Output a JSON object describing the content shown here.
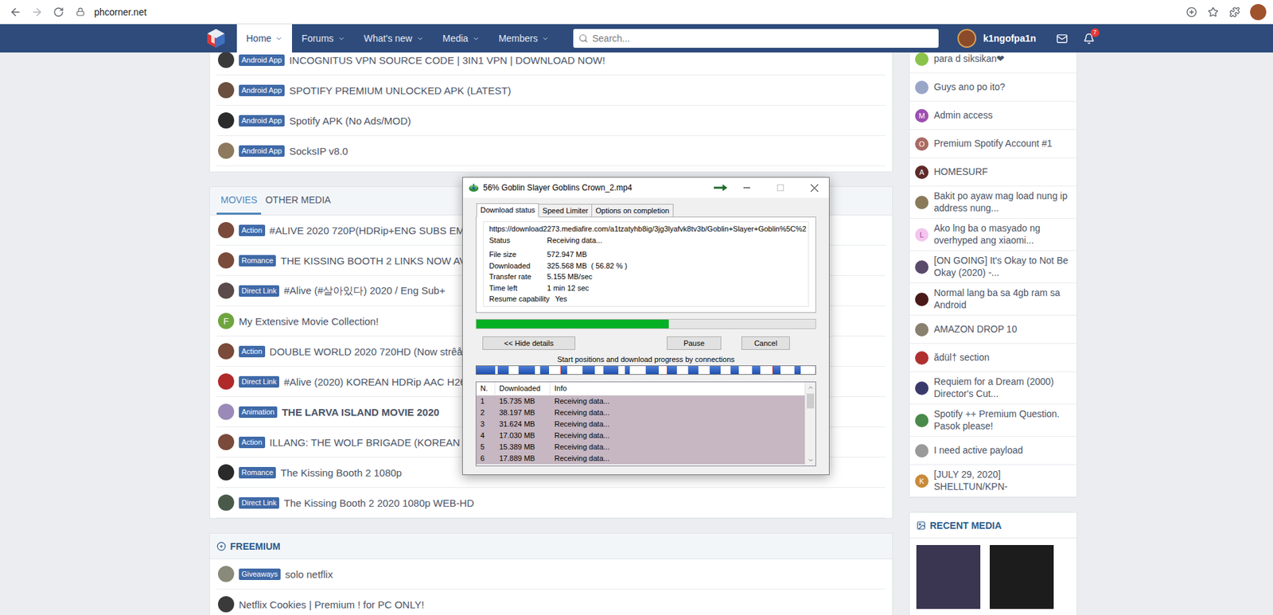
{
  "browser": {
    "url": "phcorner.net",
    "profile_color": "#a0522d"
  },
  "nav": {
    "items": [
      {
        "label": "Home",
        "selected": true
      },
      {
        "label": "Forums",
        "selected": false
      },
      {
        "label": "What's new",
        "selected": false
      },
      {
        "label": "Media",
        "selected": false
      },
      {
        "label": "Members",
        "selected": false
      }
    ],
    "search_placeholder": "Search...",
    "username": "k1ngofpa1n",
    "user_avatar_color": "#8a4b2a",
    "notification_count": "7"
  },
  "top_threads": [
    {
      "tag": "Android App",
      "title": "INCOGNITUS VPN SOURCE CODE | 3IN1 VPN | DOWNLOAD NOW!",
      "unread": false,
      "avatar": {
        "letter": "",
        "color": "#3a3a3a"
      }
    },
    {
      "tag": "Android App",
      "title": "SPOTIFY PREMIUM UNLOCKED APK (LATEST)",
      "unread": false,
      "avatar": {
        "letter": "",
        "color": "#6b4f3f"
      }
    },
    {
      "tag": "Android App",
      "title": "Spotify APK (No Ads/MOD)",
      "unread": false,
      "avatar": {
        "letter": "",
        "color": "#2b2b2b"
      }
    },
    {
      "tag": "Android App",
      "title": "SocksIP v8.0",
      "unread": false,
      "avatar": {
        "letter": "",
        "color": "#8d7a5e"
      }
    }
  ],
  "movies": {
    "tabs": [
      {
        "label": "MOVIES",
        "selected": true
      },
      {
        "label": "OTHER MEDIA",
        "selected": false
      }
    ],
    "rows": [
      {
        "tag": "Action",
        "title": "#ALIVE 2020 720P(HDRip+ENG SUBS EMBEDD",
        "unread": false,
        "avatar": {
          "letter": "",
          "color": "#7a4a3a"
        }
      },
      {
        "tag": "Romance",
        "title": "THE KISSING BOOTH 2 LINKS NOW AVAILAB",
        "unread": false,
        "avatar": {
          "letter": "",
          "color": "#7a4a3a"
        }
      },
      {
        "tag": "Direct Link",
        "title": "#Alive (#살아있다) 2020 / Eng Sub+",
        "unread": false,
        "avatar": {
          "letter": "",
          "color": "#5a4a4a"
        }
      },
      {
        "tag": "",
        "title": "My Extensive Movie Collection!",
        "unread": false,
        "avatar": {
          "letter": "F",
          "color": "#6fa53f"
        }
      },
      {
        "tag": "Action",
        "title": "DOUBLE WORLD 2020 720HD (Now strêåming",
        "unread": false,
        "avatar": {
          "letter": "",
          "color": "#7a4a3a"
        }
      },
      {
        "tag": "Direct Link",
        "title": "#Alive (2020) KOREAN HDRip AAC H264 [7",
        "unread": false,
        "avatar": {
          "letter": "",
          "color": "#b02a2a"
        }
      },
      {
        "tag": "Animation",
        "title": "THE LARVA ISLAND MOVIE 2020",
        "unread": true,
        "avatar": {
          "letter": "",
          "color": "#9a8ab8"
        }
      },
      {
        "tag": "Action",
        "title": "ILLANG: THE WOLF BRIGADE (KOREAN ACTION",
        "unread": false,
        "avatar": {
          "letter": "",
          "color": "#7a4a3a"
        }
      },
      {
        "tag": "Romance",
        "title": "The Kissing Booth 2 1080p",
        "unread": false,
        "avatar": {
          "letter": "",
          "color": "#2a2a2a"
        }
      },
      {
        "tag": "Direct Link",
        "title": "The Kissing Booth 2 2020 1080p WEB-HD",
        "unread": false,
        "avatar": {
          "letter": "",
          "color": "#4a5a4a"
        }
      }
    ]
  },
  "freemium": {
    "title": "FREEMIUM",
    "rows": [
      {
        "tag": "Giveaways",
        "title": "solo netflix",
        "unread": false,
        "avatar": {
          "letter": "",
          "color": "#8a8a7a"
        }
      },
      {
        "tag": "",
        "title": "Netflix Cookies | Premium ! for PC ONLY!",
        "unread": false,
        "avatar": {
          "letter": "",
          "color": "#3a3a3a"
        }
      }
    ]
  },
  "sidebar": {
    "items": [
      {
        "text": "para d siksikan❤",
        "avatar": {
          "letter": "",
          "color": "#8bc34a"
        }
      },
      {
        "text": "Guys ano po ito?",
        "avatar": {
          "letter": "",
          "color": "#9aa6c8"
        }
      },
      {
        "text": "Admin access",
        "avatar": {
          "letter": "M",
          "color": "#9b4fb0"
        }
      },
      {
        "text": "Premium Spotify Account #1",
        "avatar": {
          "letter": "O",
          "color": "#a86b64"
        }
      },
      {
        "text": "HOMESURF",
        "avatar": {
          "letter": "A",
          "color": "#5e2a2a"
        }
      },
      {
        "text": "Bakit po ayaw mag load nung ip address nung...",
        "avatar": {
          "letter": "",
          "color": "#8a7a5a"
        }
      },
      {
        "text": "Ako lng ba o masyado ng overhyped ang xiaomi...",
        "avatar": {
          "letter": "L",
          "color": "#f3c6ee"
        }
      },
      {
        "text": "[ON GOING] It's Okay to Not Be Okay (2020) -...",
        "avatar": {
          "letter": "",
          "color": "#5a4a6a"
        }
      },
      {
        "text": "Normal lang ba sa 4gb ram sa Android",
        "avatar": {
          "letter": "",
          "color": "#4a1a1a"
        }
      },
      {
        "text": "AMAZON DROP 10",
        "avatar": {
          "letter": "",
          "color": "#8a8070"
        }
      },
      {
        "text": "ădül† section",
        "avatar": {
          "letter": "",
          "color": "#b03030"
        }
      },
      {
        "text": "Requiem for a Dream (2000) Director's Cut...",
        "avatar": {
          "letter": "",
          "color": "#3a3a6a"
        }
      },
      {
        "text": "Spotify ++ Premium Question. Pasok please!",
        "avatar": {
          "letter": "",
          "color": "#4a8a4a"
        }
      },
      {
        "text": "I need active payload",
        "avatar": {
          "letter": "",
          "color": "#9a9a9a"
        }
      },
      {
        "text": "[JULY 29, 2020] SHELLTUN/KPN-",
        "avatar": {
          "letter": "K",
          "color": "#c98a3a"
        }
      }
    ]
  },
  "recent_media": {
    "title": "RECENT MEDIA",
    "thumbnails": [
      {
        "color": "#3a3550"
      },
      {
        "color": "#1c1c1c"
      }
    ]
  },
  "download": {
    "title": "56% Goblin Slayer Goblins Crown_2.mp4",
    "tabs": [
      {
        "label": "Download status",
        "selected": true
      },
      {
        "label": "Speed Limiter",
        "selected": false
      },
      {
        "label": "Options on completion",
        "selected": false
      }
    ],
    "url": "https://download2273.mediafire.com/a1tzatyhb8ig/3jg3lyafvk8tv3b/Goblin+Slayer+Goblin%5C%2",
    "status": {
      "label": "Status",
      "value": "Receiving data..."
    },
    "fields": [
      {
        "label": "File size",
        "value": "572.947 MB"
      },
      {
        "label": "Downloaded",
        "value": "325.568 MB  ( 56.82 % )"
      },
      {
        "label": "Transfer rate",
        "value": "5.155 MB/sec"
      },
      {
        "label": "Time left",
        "value": "1 min 12 sec"
      },
      {
        "label": "Resume capability",
        "value": "Yes"
      }
    ],
    "progress": {
      "level": 0.5682
    },
    "buttons": [
      "<< Hide details",
      "Pause",
      "Cancel"
    ],
    "connections_label": "Start positions and download progress by connections",
    "segments": [
      0.92,
      0.55,
      0.8,
      0.45,
      0.3,
      0.6,
      0.72,
      0.25,
      0.62,
      0.48,
      0.5,
      0.55,
      0.4,
      0.42,
      0.35,
      0.3
    ],
    "columns": [
      "N.",
      "Downloaded",
      "Info"
    ],
    "connections": [
      {
        "n": "1",
        "downloaded": "15.735 MB",
        "info": "Receiving data...",
        "active": true
      },
      {
        "n": "2",
        "downloaded": "38.197 MB",
        "info": "Receiving data...",
        "active": true
      },
      {
        "n": "3",
        "downloaded": "31.624 MB",
        "info": "Receiving data...",
        "active": true
      },
      {
        "n": "4",
        "downloaded": "17.030 MB",
        "info": "Receiving data...",
        "active": true
      },
      {
        "n": "5",
        "downloaded": "15.389 MB",
        "info": "Receiving data...",
        "active": true
      },
      {
        "n": "6",
        "downloaded": "17.889 MB",
        "info": "Receiving data...",
        "active": true
      }
    ]
  }
}
